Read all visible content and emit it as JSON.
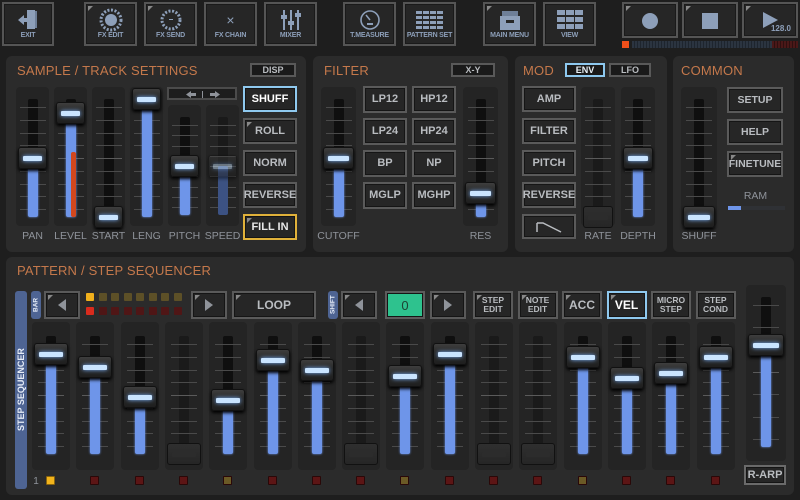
{
  "toolbar": {
    "buttons": [
      {
        "id": "exit",
        "label": "EXIT",
        "icon": "exit-door-icon"
      },
      {
        "id": "fx-edit",
        "label": "FX EDIT",
        "icon": "sun-burst-icon"
      },
      {
        "id": "fx-send",
        "label": "FX SEND",
        "icon": "dashed-circle-icon"
      },
      {
        "id": "fx-chain",
        "label": "FX CHAIN",
        "icon": "x-icon",
        "glyph": "×"
      },
      {
        "id": "mixer",
        "label": "MIXER",
        "icon": "mixer-sliders-icon"
      },
      {
        "id": "t-measure",
        "label": "T.MEASURE",
        "icon": "gauge-icon"
      },
      {
        "id": "pattern-set",
        "label": "PATTERN SET",
        "icon": "grid-icon"
      },
      {
        "id": "main-menu",
        "label": "MAIN MENU",
        "icon": "drawer-icon"
      },
      {
        "id": "view",
        "label": "VIEW",
        "icon": "grid-view-icon"
      }
    ],
    "transport": {
      "record_icon": "record-icon",
      "stop_icon": "stop-icon",
      "play_icon": "play-icon",
      "tempo": "128.0"
    },
    "position_progress": 0.02
  },
  "sample_track": {
    "title": "SAMPLE / TRACK SETTINGS",
    "disp_label": "DISP",
    "direction_icon": "left-right-arrows-icon",
    "faders": [
      {
        "label": "PAN",
        "value": 0.5
      },
      {
        "label": "LEVEL",
        "value": 0.88,
        "meter": 0.55
      },
      {
        "label": "START",
        "value": 0.0
      },
      {
        "label": "LENG",
        "value": 1.0
      },
      {
        "label": "PITCH",
        "value": 0.5
      },
      {
        "label": "SPEED",
        "value": 0.5,
        "disabled": true
      }
    ],
    "buttons": [
      {
        "label": "SHUFF",
        "state": "on"
      },
      {
        "label": "ROLL",
        "state": "off",
        "corner": true
      },
      {
        "label": "NORM",
        "state": "off"
      },
      {
        "label": "REVERSE",
        "state": "off"
      },
      {
        "label": "FILL IN",
        "state": "fill",
        "corner": true
      }
    ]
  },
  "filter": {
    "title": "FILTER",
    "xy_label": "X-Y",
    "types": [
      "LP12",
      "HP12",
      "LP24",
      "HP24",
      "BP",
      "NP",
      "MGLP",
      "MGHP"
    ],
    "cutoff": {
      "label": "CUTOFF",
      "value": 0.5
    },
    "res": {
      "label": "RES",
      "value": 0.2
    }
  },
  "mod": {
    "title": "MOD",
    "tabs": [
      {
        "label": "ENV",
        "active": true
      },
      {
        "label": "LFO",
        "active": false
      }
    ],
    "targets": [
      "AMP",
      "FILTER",
      "PITCH",
      "REVERSE"
    ],
    "shape_icon": "envelope-shape-icon",
    "rate": {
      "label": "RATE",
      "value": 0.0,
      "disabled": true
    },
    "depth": {
      "label": "DEPTH",
      "value": 0.5
    }
  },
  "common": {
    "title": "COMMON",
    "shuff": {
      "label": "SHUFF",
      "value": 0.0
    },
    "buttons": [
      "SETUP",
      "HELP",
      "FINETUNE"
    ],
    "ram_label": "RAM",
    "ram_usage": 0.12
  },
  "sequencer": {
    "title": "PATTERN / STEP SEQUENCER",
    "side_label": "STEP SEQUENCER",
    "bar_label": "BAR",
    "shift_label": "SHIFT",
    "bar_leds_top": [
      "on",
      "dim",
      "dim",
      "dim",
      "dim",
      "dim",
      "dim",
      "dim"
    ],
    "bar_leds_bottom": [
      "on",
      "dim",
      "dim",
      "dim",
      "dim",
      "dim",
      "dim",
      "dim"
    ],
    "loop_label": "LOOP",
    "shift_value": "0",
    "mode_buttons": [
      {
        "label": "STEP EDIT",
        "corner": true,
        "active": false
      },
      {
        "label": "NOTE EDIT",
        "corner": true,
        "active": false
      },
      {
        "label": "ACC",
        "corner": true,
        "active": false
      },
      {
        "label": "VEL",
        "corner": true,
        "active": true
      },
      {
        "label": "MICRO STEP",
        "corner": false,
        "active": false
      },
      {
        "label": "STEP COND",
        "corner": false,
        "active": false
      }
    ],
    "page_number": "1",
    "steps": [
      {
        "value": 0.85,
        "on": true,
        "lamp": "yellow"
      },
      {
        "value": 0.74,
        "on": true,
        "lamp": "red"
      },
      {
        "value": 0.48,
        "on": true,
        "lamp": "red"
      },
      {
        "value": 0.0,
        "on": false,
        "lamp": "red"
      },
      {
        "value": 0.46,
        "on": true,
        "lamp": "olive"
      },
      {
        "value": 0.8,
        "on": true,
        "lamp": "red"
      },
      {
        "value": 0.71,
        "on": true,
        "lamp": "red"
      },
      {
        "value": 0.0,
        "on": false,
        "lamp": "red"
      },
      {
        "value": 0.66,
        "on": true,
        "lamp": "olive"
      },
      {
        "value": 0.85,
        "on": true,
        "lamp": "red"
      },
      {
        "value": 0.0,
        "on": false,
        "lamp": "red"
      },
      {
        "value": 0.0,
        "on": false,
        "lamp": "red"
      },
      {
        "value": 0.82,
        "on": true,
        "lamp": "olive"
      },
      {
        "value": 0.64,
        "on": true,
        "lamp": "red"
      },
      {
        "value": 0.69,
        "on": true,
        "lamp": "red"
      },
      {
        "value": 0.82,
        "on": true,
        "lamp": "red"
      }
    ],
    "r_arp": {
      "label": "R-ARP",
      "value": 0.68
    }
  }
}
